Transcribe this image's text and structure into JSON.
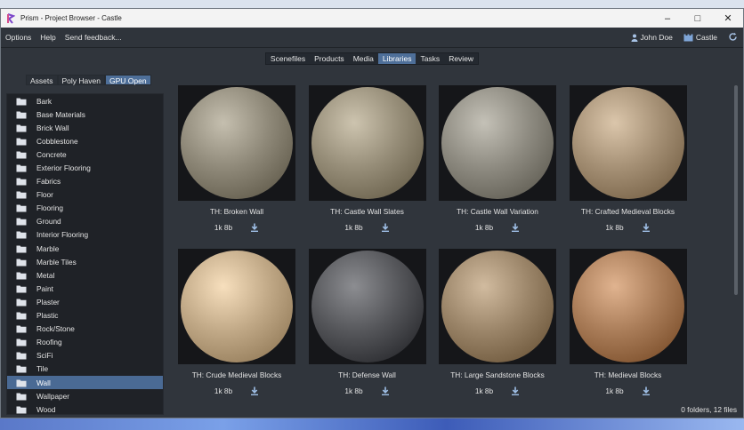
{
  "window": {
    "title": "Prism - Project Browser - Castle"
  },
  "menubar": {
    "items": [
      "Options",
      "Help",
      "Send feedback..."
    ],
    "user": "John Doe",
    "project": "Castle"
  },
  "tabs": [
    "Scenefiles",
    "Products",
    "Media",
    "Libraries",
    "Tasks",
    "Review"
  ],
  "active_tab": "Libraries",
  "subtabs": [
    "Assets",
    "Poly Haven",
    "GPU Open"
  ],
  "active_subtab": "GPU Open",
  "categories": [
    "Bark",
    "Base Materials",
    "Brick Wall",
    "Cobblestone",
    "Concrete",
    "Exterior Flooring",
    "Fabrics",
    "Floor",
    "Flooring",
    "Ground",
    "Interior Flooring",
    "Marble",
    "Marble Tiles",
    "Metal",
    "Paint",
    "Plaster",
    "Plastic",
    "Rock/Stone",
    "Roofing",
    "SciFi",
    "Tile",
    "Wall",
    "Wallpaper",
    "Wood"
  ],
  "selected_category": "Wall",
  "materials": [
    {
      "name": "TH: Broken Wall",
      "size": "1k 8b",
      "color": "#8e8878"
    },
    {
      "name": "TH: Castle Wall Slates",
      "size": "1k 8b",
      "color": "#968d78"
    },
    {
      "name": "TH: Castle Wall Variation",
      "size": "1k 8b",
      "color": "#8d8a80"
    },
    {
      "name": "TH: Crafted Medieval Blocks",
      "size": "1k 8b",
      "color": "#a48f74"
    },
    {
      "name": "TH: Crude Medieval Blocks",
      "size": "1k 8b",
      "color": "#c0a886"
    },
    {
      "name": "TH: Defense Wall",
      "size": "1k 8b",
      "color": "#55565a"
    },
    {
      "name": "TH: Large Sandstone Blocks",
      "size": "1k 8b",
      "color": "#9a8468"
    },
    {
      "name": "TH: Medieval Blocks",
      "size": "1k 8b",
      "color": "#a97c58"
    }
  ],
  "status": "0 folders, 12 files",
  "colors": {
    "accent": "#4e6f99",
    "background": "#30353c",
    "panel": "#1f2227",
    "folder": "#dfe3ea"
  },
  "icons": [
    "prism-logo-icon",
    "minimize-icon",
    "maximize-icon",
    "close-icon",
    "user-icon",
    "project-icon",
    "refresh-icon",
    "folder-icon",
    "download-icon"
  ]
}
